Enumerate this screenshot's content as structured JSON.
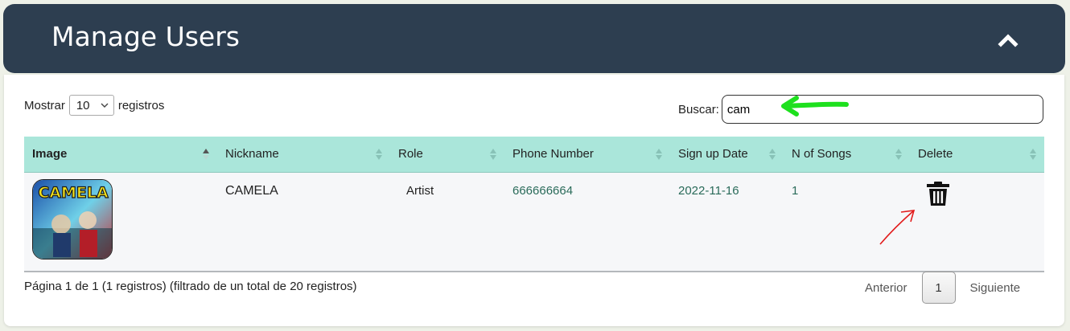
{
  "header": {
    "title": "Manage Users"
  },
  "controls": {
    "length_prefix": "Mostrar",
    "length_value": "10",
    "length_suffix": "registros",
    "search_label": "Buscar:",
    "search_value": "cam"
  },
  "table": {
    "columns": [
      "Image",
      "Nickname",
      "Role",
      "Phone Number",
      "Sign up Date",
      "N of Songs",
      "Delete"
    ],
    "rows": [
      {
        "image_text": "CAMELA",
        "nickname": "CAMELA",
        "role": "Artist",
        "phone": "666666664",
        "signup": "2022-11-16",
        "songs": "1"
      }
    ]
  },
  "footer": {
    "info": "Página 1 de 1 (1 registros) (filtrado de un total de 20 registros)",
    "prev": "Anterior",
    "page": "1",
    "next": "Siguiente"
  },
  "colors": {
    "header_bg": "#2d3e50",
    "table_head_bg": "#aae6da",
    "link_text": "#2a6b5a",
    "annotation_green": "#1ee01e",
    "annotation_red": "#e21b1b"
  }
}
